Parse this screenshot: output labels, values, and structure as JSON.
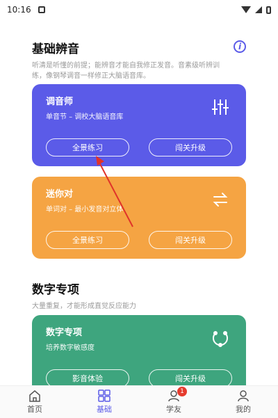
{
  "status_bar": {
    "time": "10:16"
  },
  "section1": {
    "title": "基础辨音",
    "desc_line1": "听清是听懂的前提；能辨音才能自我修正发音。音素级听辨训",
    "desc_line2": "练，像钢琴调音一样修正大脑语音库。"
  },
  "card_tuner": {
    "title": "调音师",
    "subtitle": "单音节 – 调校大脑语音库",
    "btn_left": "全景练习",
    "btn_right": "闯关升级",
    "color": "#5b5be8",
    "icon": "sliders-icon"
  },
  "card_minipair": {
    "title": "迷你对",
    "subtitle": "单词对 – 最小发音对立体",
    "btn_left": "全景练习",
    "btn_right": "闯关升级",
    "color": "#f5a443",
    "icon": "swap-arrows-icon"
  },
  "section2": {
    "title": "数字专项",
    "desc": "大量重复，才能形成直觉反应能力"
  },
  "card_numbers": {
    "title": "数字专项",
    "subtitle": "培养数字敏感度",
    "btn_left": "影音体验",
    "btn_right": "闯关升级",
    "color": "#3ea57e",
    "icon": "orbit-icon"
  },
  "bottom_nav": {
    "items": [
      {
        "label": "首页"
      },
      {
        "label": "基础"
      },
      {
        "label": "学友",
        "badge": "1"
      },
      {
        "label": "我的"
      }
    ]
  },
  "annotation_color": "#e0332a"
}
